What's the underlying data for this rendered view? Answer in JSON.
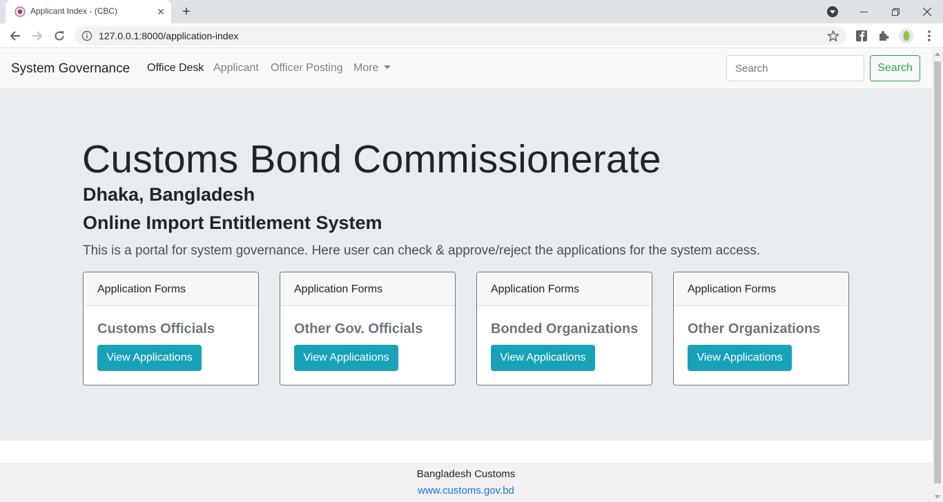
{
  "browser": {
    "tab_title": "Applicant Index - (CBC)",
    "tab_close": "✕",
    "new_tab": "+",
    "url": "127.0.0.1:8000/application-index"
  },
  "navbar": {
    "brand": "System Governance",
    "links": [
      "Office Desk",
      "Applicant",
      "Officer Posting",
      "More"
    ],
    "search_placeholder": "Search",
    "search_button": "Search"
  },
  "hero": {
    "title": "Customs Bond Commissionerate",
    "location": "Dhaka, Bangladesh",
    "system": "Online Import Entitlement System",
    "description": "This is a portal for system governance. Here user can check & approve/reject the applications for the system access."
  },
  "cards": [
    {
      "header": "Application Forms",
      "title": "Customs Officials",
      "button": "View Applications"
    },
    {
      "header": "Application Forms",
      "title": "Other Gov. Officials",
      "button": "View Applications"
    },
    {
      "header": "Application Forms",
      "title": "Bonded Organizations",
      "button": "View Applications"
    },
    {
      "header": "Application Forms",
      "title": "Other Organizations",
      "button": "View Applications"
    }
  ],
  "footer": {
    "org": "Bangladesh Customs",
    "link": "www.customs.gov.bd"
  },
  "colors": {
    "primary_info": "#17a2b8",
    "success": "#28a745",
    "jumbotron_bg": "#e9ecef",
    "link": "#1a73e8"
  }
}
